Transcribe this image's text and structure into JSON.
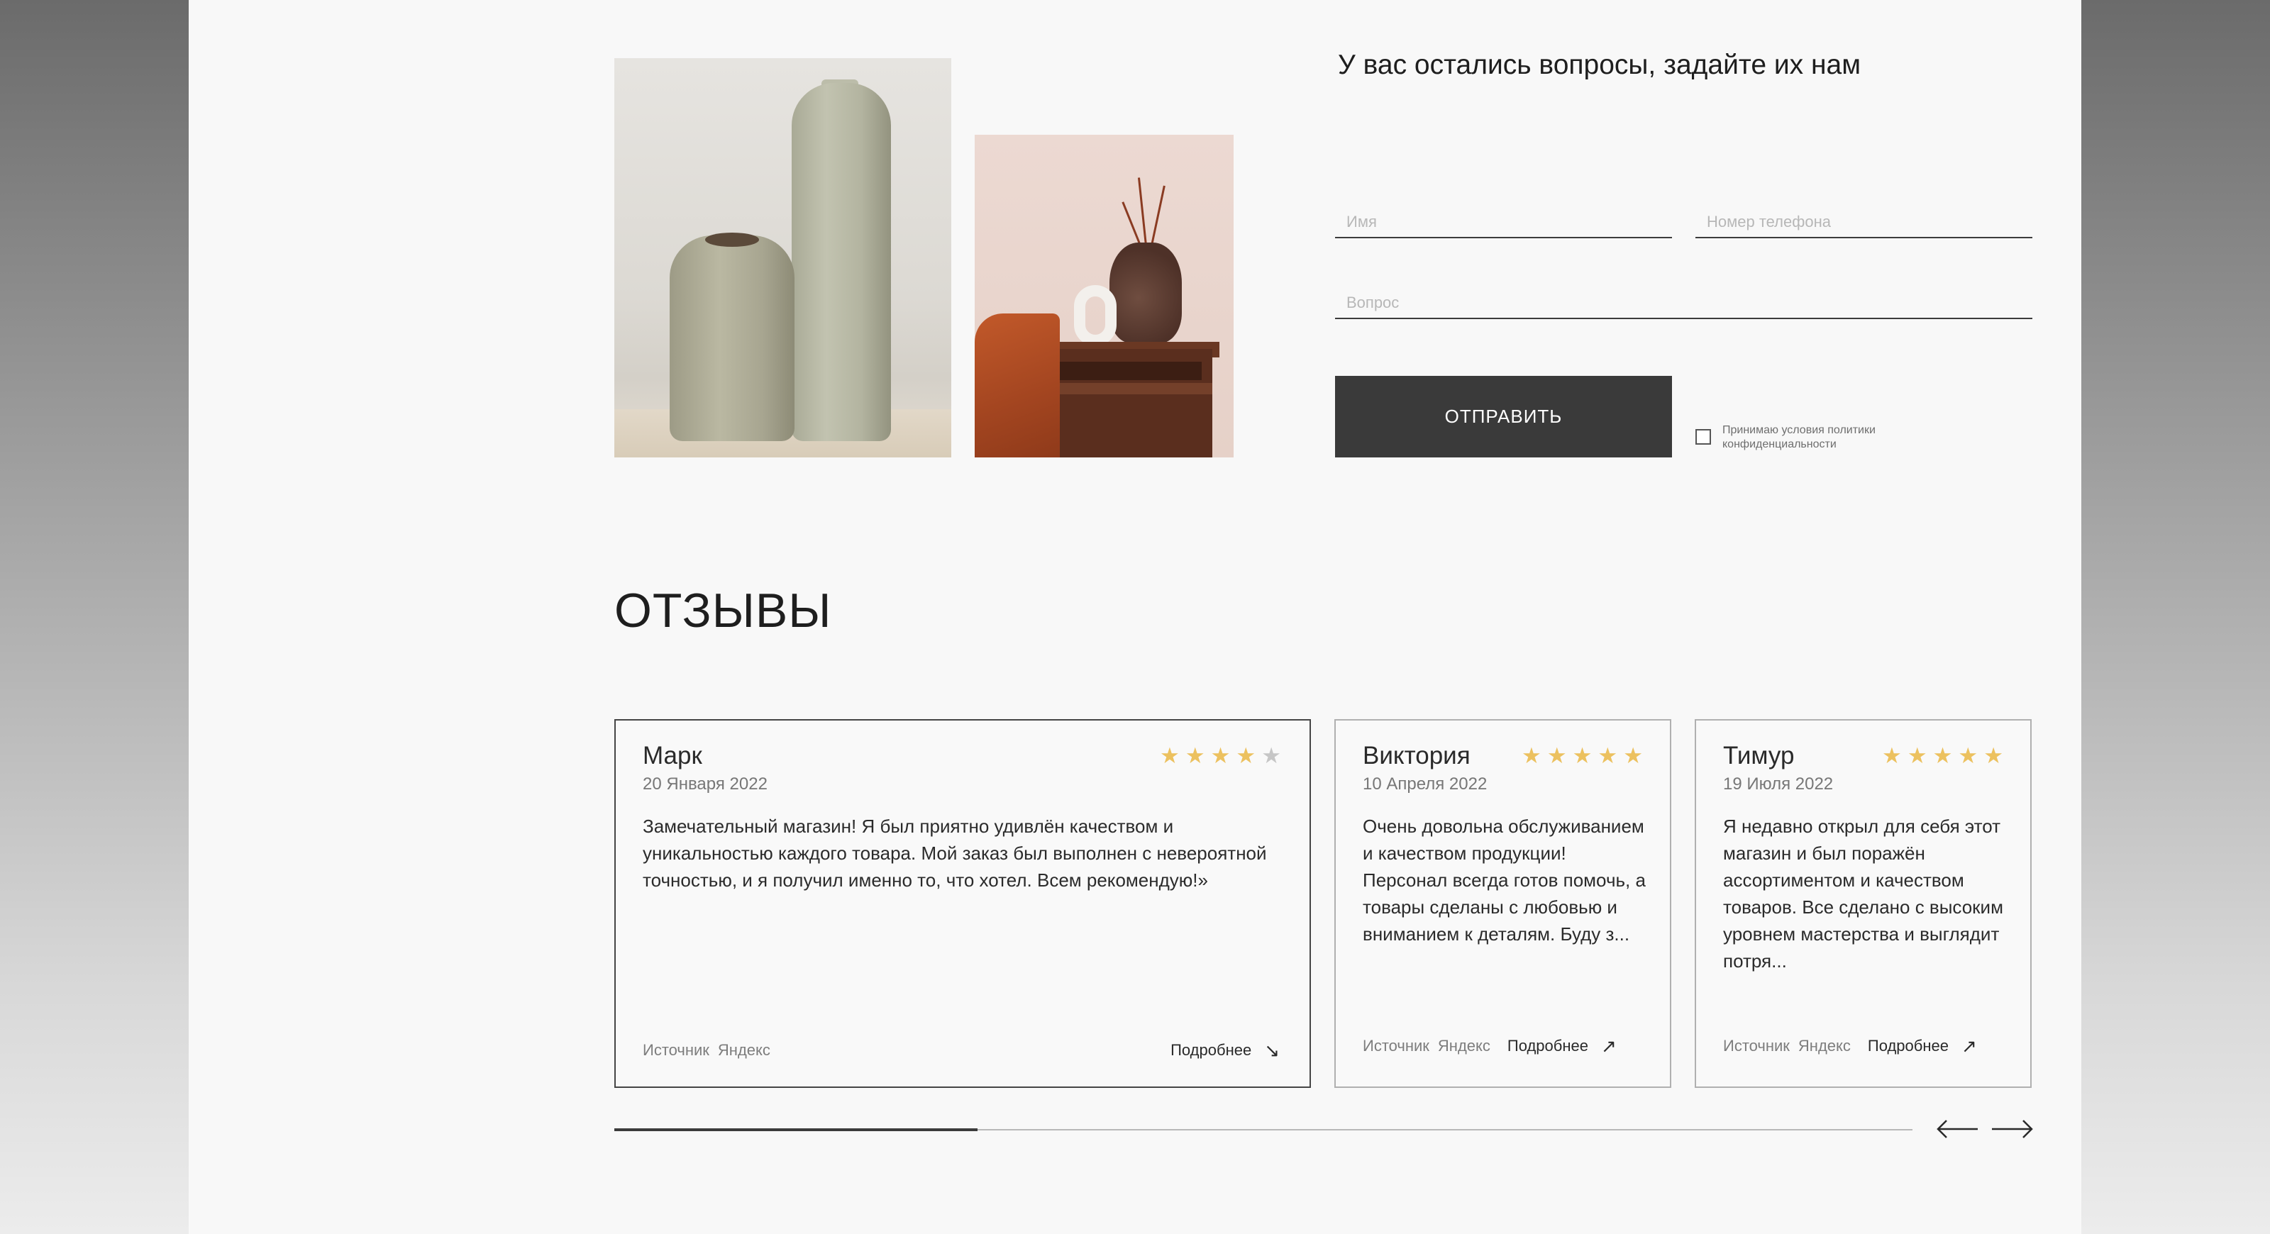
{
  "form": {
    "title": "У вас остались вопросы, задайте их нам",
    "name_placeholder": "Имя",
    "phone_placeholder": "Номер телефона",
    "question_placeholder": "Вопрос",
    "submit_label": "ОТПРАВИТЬ",
    "consent_label": "Принимаю условия политики конфиденциальности",
    "consent_checked": false
  },
  "reviews": {
    "title": "ОТЗЫВЫ",
    "items": [
      {
        "name": "Марк",
        "date": "20 Января 2022",
        "rating": 4,
        "text": "Замечательный магазин! Я был приятно удивлён качеством и уникальностью каждого товара. Мой заказ был выполнен с невероятной точностью, и я получил именно то, что хотел. Всем рекомендую!»",
        "source_label": "Источник",
        "source_name": "Яндекс",
        "more_label": "Подробнее",
        "more_icon": "arrow-down-right-icon"
      },
      {
        "name": "Виктория",
        "date": "10 Апреля 2022",
        "rating": 5,
        "text": "Очень довольна обслуживанием и качеством продукции! Персонал всегда готов помочь, а товары сделаны с любовью и вниманием к деталям. Буду з...",
        "source_label": "Источник",
        "source_name": "Яндекс",
        "more_label": "Подробнее",
        "more_icon": "arrow-up-right-icon"
      },
      {
        "name": "Тимур",
        "date": "19 Июля 2022",
        "rating": 5,
        "text": "Я недавно открыл для себя этот магазин и был поражён ассортиментом и качеством товаров. Все сделано с высоким уровнем мастерства и выглядит потря...",
        "source_label": "Источник",
        "source_name": "Яндекс",
        "more_label": "Подробнее",
        "more_icon": "arrow-up-right-icon"
      }
    ],
    "carousel_progress": 0.28
  },
  "colors": {
    "star": "#ecc15f",
    "star_off": "#c6c6c6",
    "button": "#3a3a3a",
    "page_bg": "#f8f8f8"
  }
}
